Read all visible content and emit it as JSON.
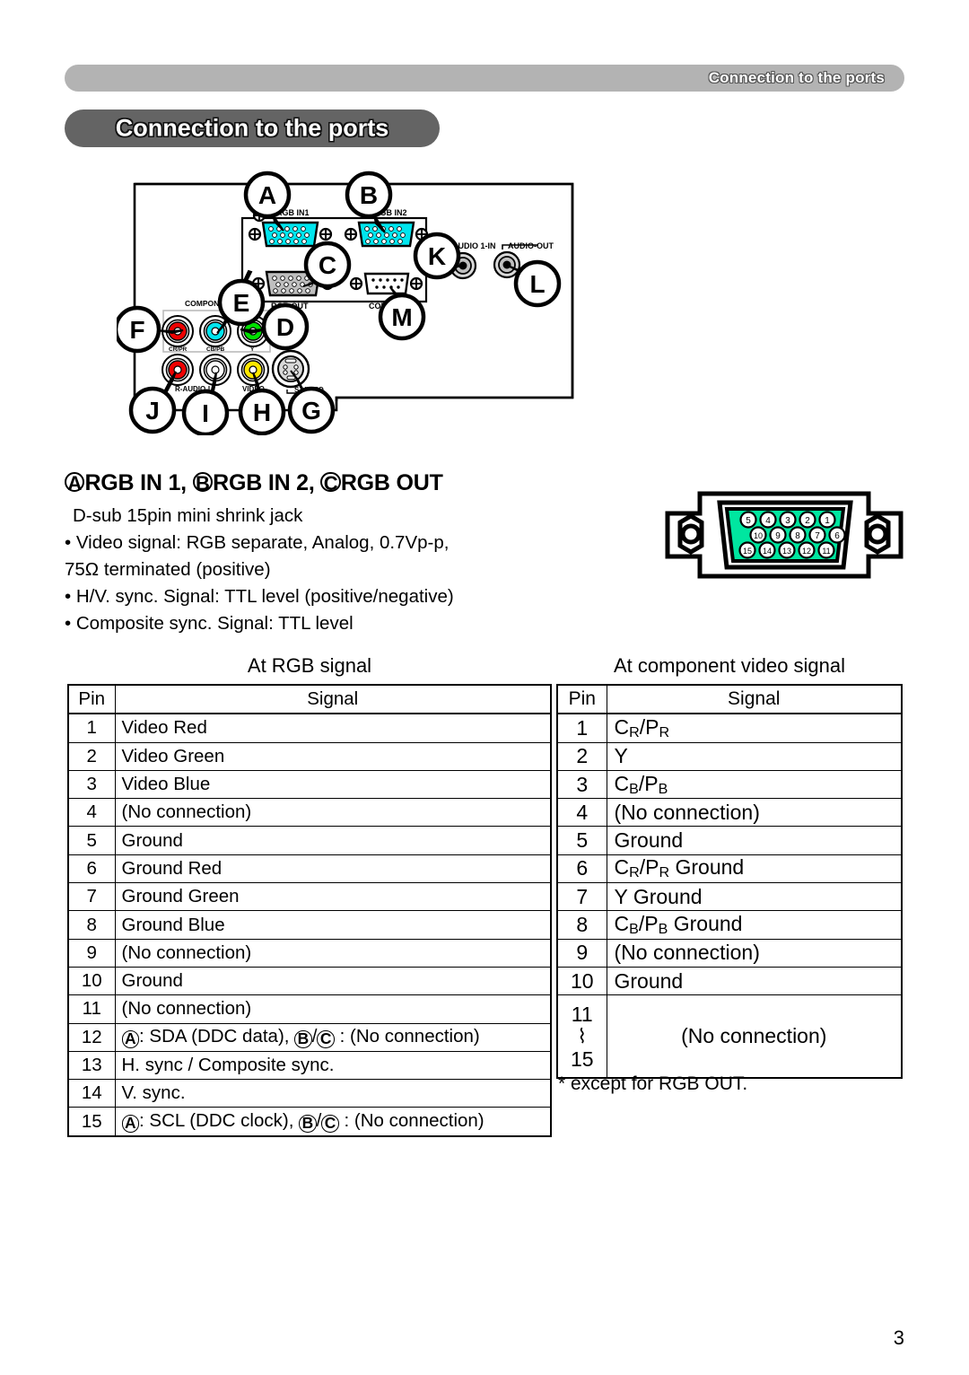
{
  "running_header": {
    "text": "Connection to the ports"
  },
  "title_banner": {
    "text": "Connection to the ports"
  },
  "diagram": {
    "callouts": [
      "A",
      "B",
      "C",
      "D",
      "E",
      "F",
      "G",
      "H",
      "I",
      "J",
      "K",
      "L",
      "M"
    ],
    "port_labels": {
      "rgb_in1": "RGB IN1",
      "rgb_in2": "RGB IN2",
      "rgb_out": "RGB OUT",
      "control": "CONTROL",
      "audio_in": "AUDIO 1-IN",
      "audio_out": "AUDIO-OUT",
      "component": "COMPONENT",
      "component_cr": "CR/PR",
      "component_cb": "CB/PB",
      "component_y": "Y",
      "r_audio_l": "R-AUDIO-L",
      "video": "VIDEO",
      "s_video": "S-VIDEO"
    },
    "colors": {
      "dsub_cyan": "#00e5ee",
      "dsub_gray": "#bfbfbf",
      "rca_red": "#ee0000",
      "rca_cyan": "#00e5ee",
      "rca_green": "#00e000",
      "rca_yellow": "#ffe800",
      "rca_white": "#ffffff"
    }
  },
  "section": {
    "heading_parts": [
      "A",
      "RGB IN 1, ",
      "B",
      "RGB IN 2, ",
      "C",
      "RGB OUT"
    ],
    "heading_a": "A",
    "heading_t1": "RGB IN 1, ",
    "heading_b": "B",
    "heading_t2": "RGB IN 2, ",
    "heading_c": "C",
    "heading_t3": "RGB OUT",
    "spec_lines": [
      "D-sub 15pin mini shrink jack",
      "• Video signal: RGB separate, Analog, 0.7Vp-p,",
      "75Ω terminated (positive)",
      "• H/V. sync. Signal: TTL level (positive/negative)",
      "• Composite sync. Signal: TTL level"
    ],
    "spec_line_1": "D-sub 15pin mini shrink jack",
    "spec_line_2": "• Video signal: RGB separate, Analog, 0.7Vp-p,",
    "spec_line_3": "75Ω terminated (positive)",
    "spec_line_4": "• H/V. sync. Signal: TTL level (positive/negative)",
    "spec_line_5": "• Composite sync. Signal: TTL level"
  },
  "dsub_connector": {
    "shell_color": "#00e6a0",
    "pin_rows": [
      [
        "5",
        "4",
        "3",
        "2",
        "1"
      ],
      [
        "10",
        "9",
        "8",
        "7",
        "6"
      ],
      [
        "15",
        "14",
        "13",
        "12",
        "11"
      ]
    ]
  },
  "rgb_table": {
    "title": "At RGB signal",
    "headers": {
      "pin": "Pin",
      "signal": "Signal"
    },
    "rows": [
      {
        "pin": "1",
        "signal": "Video Red"
      },
      {
        "pin": "2",
        "signal": "Video Green"
      },
      {
        "pin": "3",
        "signal": "Video Blue"
      },
      {
        "pin": "4",
        "signal": "(No connection)"
      },
      {
        "pin": "5",
        "signal": "Ground"
      },
      {
        "pin": "6",
        "signal": "Ground Red"
      },
      {
        "pin": "7",
        "signal": "Ground Green"
      },
      {
        "pin": "8",
        "signal": "Ground Blue"
      },
      {
        "pin": "9",
        "signal": "(No connection)"
      },
      {
        "pin": "10",
        "signal": "Ground"
      },
      {
        "pin": "11",
        "signal": "(No connection)"
      },
      {
        "pin": "12",
        "signal": "A: SDA (DDC data), B/C : (No connection)"
      },
      {
        "pin": "13",
        "signal": "H. sync / Composite sync."
      },
      {
        "pin": "14",
        "signal": "V. sync."
      },
      {
        "pin": "15",
        "signal": "A: SCL (DDC clock), B/C : (No connection)"
      }
    ],
    "row12": {
      "circ_a": "A",
      "text_a": ": SDA (DDC data), ",
      "circ_b": "B",
      "slash": "/",
      "circ_c": "C",
      "text_b": " : (No connection)"
    },
    "row15": {
      "circ_a": "A",
      "text_a": ": SCL (DDC clock), ",
      "circ_b": "B",
      "slash": "/",
      "circ_c": "C",
      "text_b": " : (No connection)"
    }
  },
  "component_table": {
    "title": "At component video signal",
    "headers": {
      "pin": "Pin",
      "signal": "Signal"
    },
    "rows": [
      {
        "pin": "1",
        "signal": "CR/PR"
      },
      {
        "pin": "2",
        "signal": "Y"
      },
      {
        "pin": "3",
        "signal": "CB/PB"
      },
      {
        "pin": "4",
        "signal": "(No connection)"
      },
      {
        "pin": "5",
        "signal": "Ground"
      },
      {
        "pin": "6",
        "signal": "CR/PR Ground"
      },
      {
        "pin": "7",
        "signal": "Y Ground"
      },
      {
        "pin": "8",
        "signal": "CB/PB Ground"
      },
      {
        "pin": "9",
        "signal": "(No connection)"
      },
      {
        "pin": "10",
        "signal": "Ground"
      }
    ],
    "merged_row": {
      "pin_from": "11",
      "pin_tilde": "⌇",
      "pin_to": "15",
      "signal": "(No connection)"
    },
    "footnote": "* except for RGB OUT."
  },
  "page_number": "3"
}
